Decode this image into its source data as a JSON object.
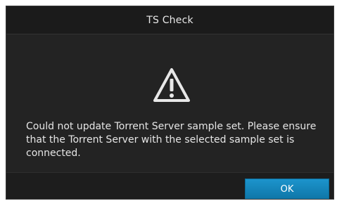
{
  "dialog": {
    "title": "TS Check",
    "icon": "warning-icon",
    "message": "Could not update Torrent Server sample set. Please ensure that the Torrent Server with the selected sample set is connected.",
    "ok_label": "OK"
  },
  "colors": {
    "background": "#232323",
    "accent": "#1386bd",
    "text": "#e6e6e6"
  }
}
